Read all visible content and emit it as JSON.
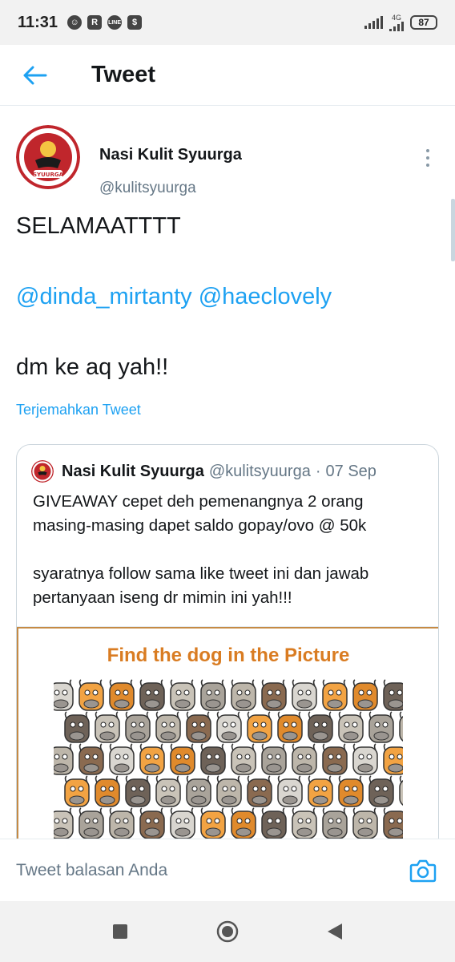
{
  "status_bar": {
    "time": "11:31",
    "network": "4G",
    "battery": "87",
    "notif_icons": [
      "snapchat-icon",
      "r-app-icon",
      "line-icon",
      "shop-icon"
    ]
  },
  "header": {
    "title": "Tweet",
    "back_icon": "arrow-left-icon"
  },
  "tweet": {
    "author_name": "Nasi Kulit Syuurga",
    "author_handle": "@kulitsyuurga",
    "avatar_text": "NASI KULIT SYUURGA",
    "line1": "SELAMAATTTT",
    "mention1": "@dinda_mirtanty",
    "mention2": "@haeclovely",
    "line3": "dm ke aq yah!!",
    "translate": "Terjemahkan Tweet"
  },
  "quote": {
    "name": "Nasi Kulit Syuurga",
    "handle": "@kulitsyuurga",
    "dot": "·",
    "date": "07 Sep",
    "line1": "GIVEAWAY cepet deh pemenangnya 2 orang",
    "line2": "masing-masing dapet saldo gopay/ovo @ 50k",
    "line3": "syaratnya follow sama like tweet ini dan jawab",
    "line4": "pertanyaan iseng dr mimin ini yah!!!",
    "image_title": "Find the dog in the Picture"
  },
  "reply": {
    "placeholder": "Tweet balasan Anda",
    "camera_icon": "camera-icon"
  },
  "colors": {
    "accent": "#1da1f2",
    "text": "#14171a",
    "muted": "#657786",
    "image_title": "#d97c22"
  }
}
